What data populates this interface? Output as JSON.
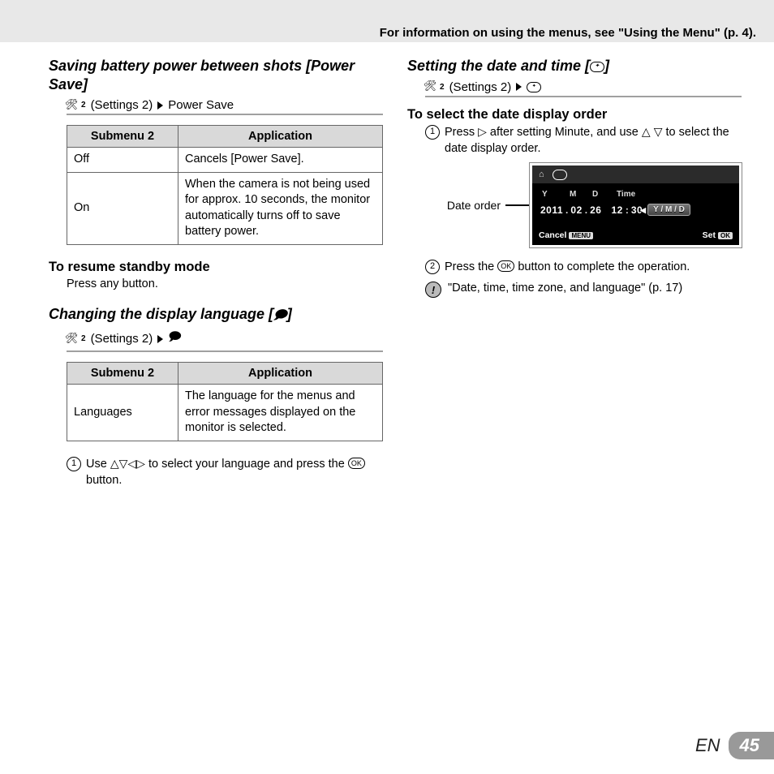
{
  "header": {
    "note": "For information on using the menus, see \"Using the Menu\" (p. 4)."
  },
  "left": {
    "powerSave": {
      "title": "Saving battery power between shots [Power Save]",
      "crumb": {
        "group": "(Settings 2)",
        "leaf": "Power Save"
      },
      "table": {
        "h1": "Submenu 2",
        "h2": "Application",
        "rows": [
          {
            "a": "Off",
            "b": "Cancels [Power Save]."
          },
          {
            "a": "On",
            "b": "When the camera is not being used for approx. 10 seconds, the monitor automatically turns off to save battery power."
          }
        ]
      },
      "resume": {
        "head": "To resume standby mode",
        "body": "Press any button."
      }
    },
    "lang": {
      "title": "Changing the display language [",
      "title_end": "]",
      "crumb": {
        "group": "(Settings 2)"
      },
      "table": {
        "h1": "Submenu 2",
        "h2": "Application",
        "rows": [
          {
            "a": "Languages",
            "b": "The language for the menus and error messages displayed on the monitor is selected."
          }
        ]
      },
      "step1_a": "Use ",
      "step1_b": " to select your language and press the ",
      "step1_c": " button."
    }
  },
  "right": {
    "title_a": "Setting the date and time [",
    "title_b": "]",
    "crumb": {
      "group": "(Settings 2)"
    },
    "subhead": "To select the date display order",
    "step1_a": "Press ",
    "step1_b": " after setting Minute, and use ",
    "step1_c": " to select the date display order.",
    "lcd": {
      "label": "Date order",
      "head": {
        "y": "Y",
        "m": "M",
        "d": "D",
        "t": "Time"
      },
      "vals": {
        "y": "2011",
        "m": "02",
        "d": "26",
        "hh": "12",
        "mm": "30",
        "order": "Y / M / D"
      },
      "foot": {
        "cancel": "Cancel",
        "cancel_btn": "MENU",
        "set": "Set",
        "set_btn": "OK"
      }
    },
    "step2_a": "Press the ",
    "step2_b": " button to complete the operation.",
    "note": "\"Date, time, time zone, and language\" (p. 17)"
  },
  "footer": {
    "lang": "EN",
    "page": "45"
  }
}
